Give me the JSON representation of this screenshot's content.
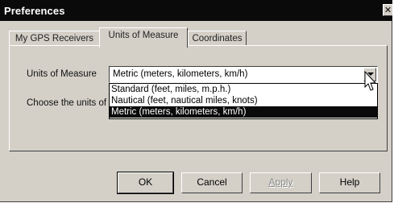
{
  "window": {
    "title": "Preferences",
    "close_glyph": "✕"
  },
  "tabs": [
    {
      "label": "My GPS Receivers",
      "active": false
    },
    {
      "label": "Units of Measure",
      "active": true
    },
    {
      "label": "Coordinates",
      "active": false
    }
  ],
  "units": {
    "label": "Units of Measure",
    "selected": "Metric (meters, kilometers, km/h)",
    "hint_text": "Choose the units of",
    "options": [
      "Standard (feet, miles, m.p.h.)",
      "Nautical (feet, nautical miles, knots)",
      "Metric (meters, kilometers, km/h)"
    ]
  },
  "buttons": {
    "ok": "OK",
    "cancel": "Cancel",
    "apply": "Apply",
    "help": "Help"
  },
  "icons": {
    "dropdown_arrow": "chevron-down-icon",
    "cursor": "mouse-pointer-icon"
  },
  "colors": {
    "face": "#d4d0c8",
    "titlebar": "#0a0a0a",
    "selection": "#0a0a0a"
  }
}
